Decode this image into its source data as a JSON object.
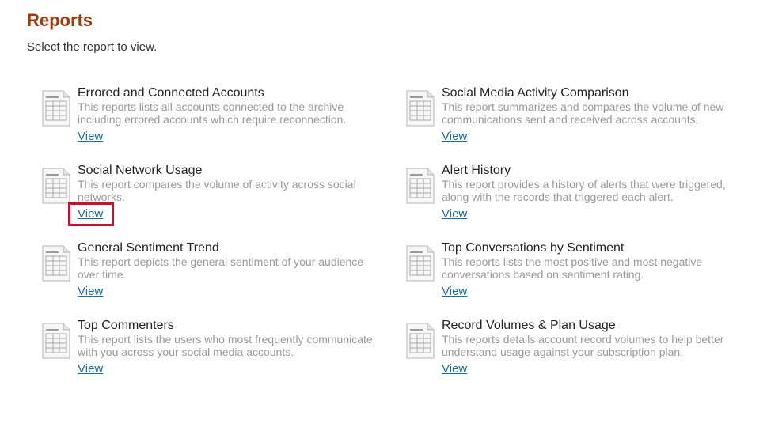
{
  "header": {
    "title": "Reports",
    "subtitle": "Select the report to view."
  },
  "reports": [
    {
      "title": "Errored and Connected Accounts",
      "description": "This reports lists all accounts connected to the archive including errored accounts which require reconnection.",
      "link": "View"
    },
    {
      "title": "Social Media Activity Comparison",
      "description": "This report summarizes and compares the volume of new communications sent and received across accounts.",
      "link": "View"
    },
    {
      "title": "Social Network Usage",
      "description": "This report compares the volume of activity across social networks.",
      "link": "View"
    },
    {
      "title": "Alert History",
      "description": "This report provides a history of alerts that were triggered, along with the records that triggered each alert.",
      "link": "View"
    },
    {
      "title": "General Sentiment Trend",
      "description": "This report depicts the general sentiment of your audience over time.",
      "link": "View"
    },
    {
      "title": "Top Conversations by Sentiment",
      "description": "This reports lists the most positive and most negative conversations based on sentiment rating.",
      "link": "View"
    },
    {
      "title": "Top Commenters",
      "description": "This report lists the users who most frequently communicate with you across your social media accounts.",
      "link": "View"
    },
    {
      "title": "Record Volumes & Plan Usage",
      "description": "This reports details account record volumes to help better understand usage against your subscription plan.",
      "link": "View"
    }
  ],
  "icon": "report-document-icon",
  "colors": {
    "title": "#a33a0e",
    "link": "#1a6fa0",
    "highlight": "#c8102e"
  }
}
